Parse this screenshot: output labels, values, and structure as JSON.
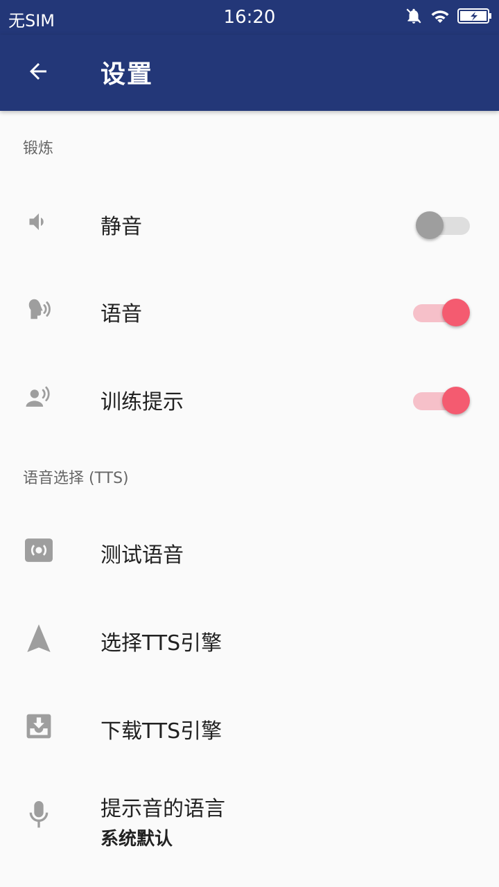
{
  "status_bar": {
    "carrier": "无SIM",
    "time": "16:20",
    "icons": [
      "bell-off-icon",
      "wifi-icon",
      "battery-charging-icon"
    ]
  },
  "app_bar": {
    "back_icon": "arrow-left-icon",
    "title": "设置"
  },
  "sections": [
    {
      "header": "锻炼",
      "items": [
        {
          "icon": "volume-icon",
          "label": "静音",
          "toggle": false
        },
        {
          "icon": "voice-speaking-icon",
          "label": "语音",
          "toggle": true
        },
        {
          "icon": "person-speaking-icon",
          "label": "训练提示",
          "toggle": true
        }
      ]
    },
    {
      "header": "语音选择 (TTS)",
      "items": [
        {
          "icon": "speaker-test-icon",
          "label": "测试语音"
        },
        {
          "icon": "navigation-arrow-icon",
          "label": "选择TTS引擎"
        },
        {
          "icon": "download-tray-icon",
          "label": "下载TTS引擎"
        },
        {
          "icon": "microphone-icon",
          "label": "提示音的语言",
          "sublabel": "系统默认"
        }
      ]
    }
  ],
  "colors": {
    "app_bar": "#233778",
    "accent": "#f45b70",
    "icon_gray": "#9e9e9e",
    "background": "#fafafa"
  }
}
